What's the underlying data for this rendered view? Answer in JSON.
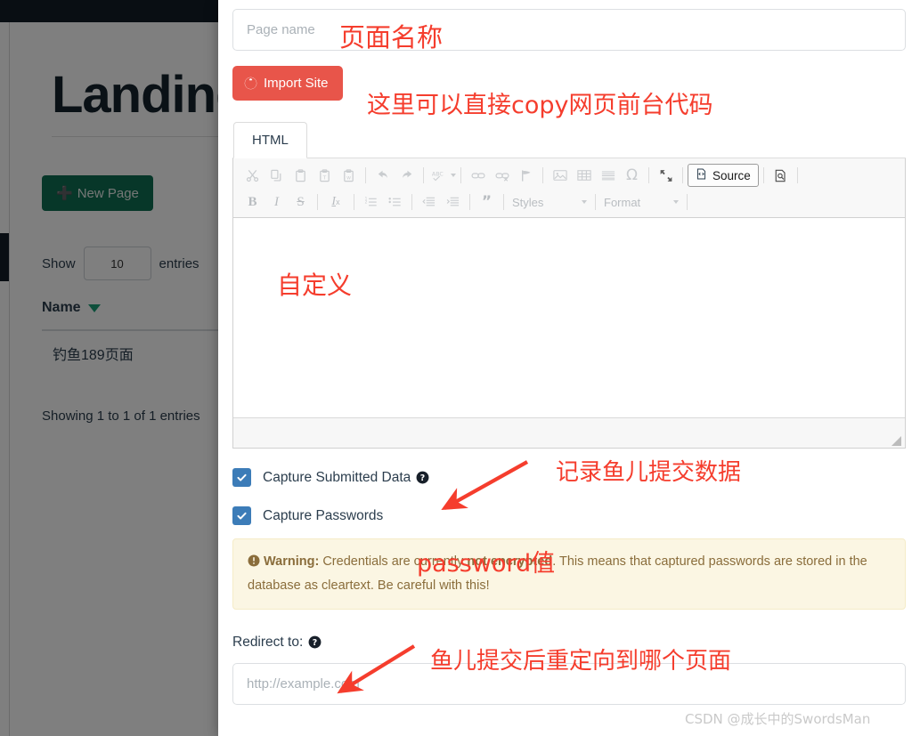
{
  "background": {
    "page_title": "Landing Pages",
    "new_page_button": "New Page",
    "show_label": "Show",
    "entries_label": "entries",
    "page_length_value": "10",
    "table": {
      "columns": [
        "Name"
      ],
      "rows": [
        [
          "钓鱼189页面"
        ]
      ],
      "info": "Showing 1 to 1 of 1 entries"
    }
  },
  "modal": {
    "page_name": {
      "placeholder": "Page name",
      "value": ""
    },
    "import_site_button": "Import Site",
    "tabs": [
      {
        "label": "HTML",
        "active": true
      }
    ],
    "editor": {
      "toolbar_row1": [
        "cut-icon",
        "copy-icon",
        "paste-icon",
        "paste-text-icon",
        "paste-word-icon",
        "undo-icon",
        "redo-icon",
        "spellcheck-icon",
        "link-icon",
        "unlink-icon",
        "anchor-icon",
        "image-icon",
        "table-icon",
        "horizontal-rule-icon",
        "special-char-icon",
        "maximize-icon",
        "source-button",
        "preview-icon"
      ],
      "toolbar_row2": [
        "bold-icon",
        "italic-icon",
        "strikethrough-icon",
        "remove-format-icon",
        "numbered-list-icon",
        "bulleted-list-icon",
        "outdent-icon",
        "indent-icon",
        "blockquote-icon",
        "styles-select",
        "format-select"
      ],
      "source_button_label": "Source",
      "styles_label": "Styles",
      "format_label": "Format",
      "content": ""
    },
    "capture_submitted_data": {
      "label": "Capture Submitted Data",
      "checked": true
    },
    "capture_passwords": {
      "label": "Capture Passwords",
      "checked": true
    },
    "warning": {
      "prefix": "Warning:",
      "text_part1": " Credentials are currently ",
      "emphasis": "not encrypted",
      "text_part2": ". This means that captured passwords are stored in the database as cleartext. Be careful with this!"
    },
    "redirect": {
      "label": "Redirect to:",
      "placeholder": "http://example.com",
      "value": ""
    }
  },
  "annotations": [
    {
      "id": "page-name",
      "text": "页面名称"
    },
    {
      "id": "import",
      "text": "这里可以直接copy网页前台代码"
    },
    {
      "id": "custom",
      "text": "自定义"
    },
    {
      "id": "capture",
      "text": "记录鱼儿提交数据"
    },
    {
      "id": "password",
      "text": "password值"
    },
    {
      "id": "redirect",
      "text": "鱼儿提交后重定向到哪个页面"
    }
  ],
  "watermark": "CSDN @成长中的SwordsMan",
  "colors": {
    "accent_red": "#e8554a",
    "annotation_red": "#f53d2d",
    "primary_green": "#0f6e52",
    "checkbox_blue": "#3c7cb8",
    "topbar_dark": "#131d26",
    "warning_bg": "#fbf6e3",
    "warning_text": "#8a6d3b"
  }
}
